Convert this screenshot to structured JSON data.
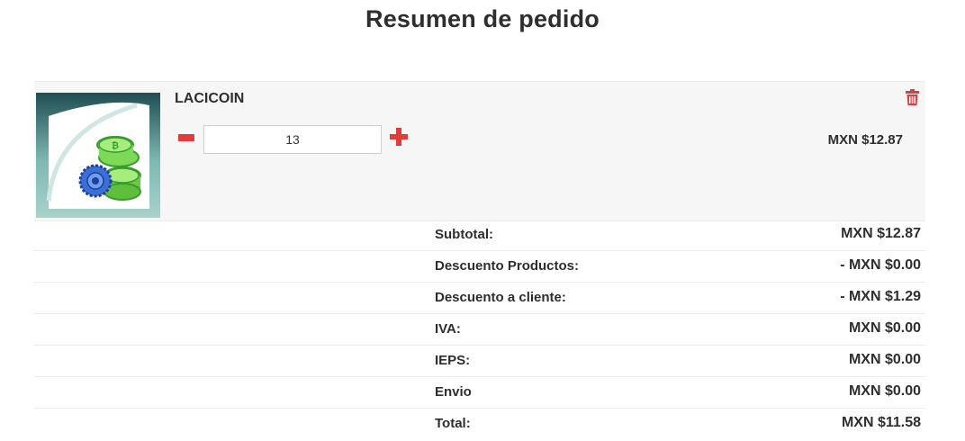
{
  "page": {
    "title": "Resumen de pedido"
  },
  "cart": {
    "item": {
      "name": "LACICOIN",
      "quantity": "13",
      "price": "MXN $12.87",
      "image_icon": "coins-product-icon"
    },
    "controls": {
      "minus_icon": "minus-icon",
      "plus_icon": "plus-icon",
      "delete_icon": "trash-icon"
    }
  },
  "summary": {
    "rows": [
      {
        "label": "Subtotal:",
        "value": "MXN $12.87"
      },
      {
        "label": "Descuento Productos:",
        "value": "- MXN $0.00"
      },
      {
        "label": "Descuento a cliente:",
        "value": "- MXN $1.29"
      },
      {
        "label": "IVA:",
        "value": "MXN $0.00"
      },
      {
        "label": "IEPS:",
        "value": "MXN $0.00"
      },
      {
        "label": "Envio",
        "value": "MXN $0.00"
      },
      {
        "label": "Total:",
        "value": "MXN $11.58"
      }
    ]
  },
  "colors": {
    "accent_red": "#e23b3b",
    "row_background": "#f6f6f6",
    "text": "#2e2e2e"
  }
}
